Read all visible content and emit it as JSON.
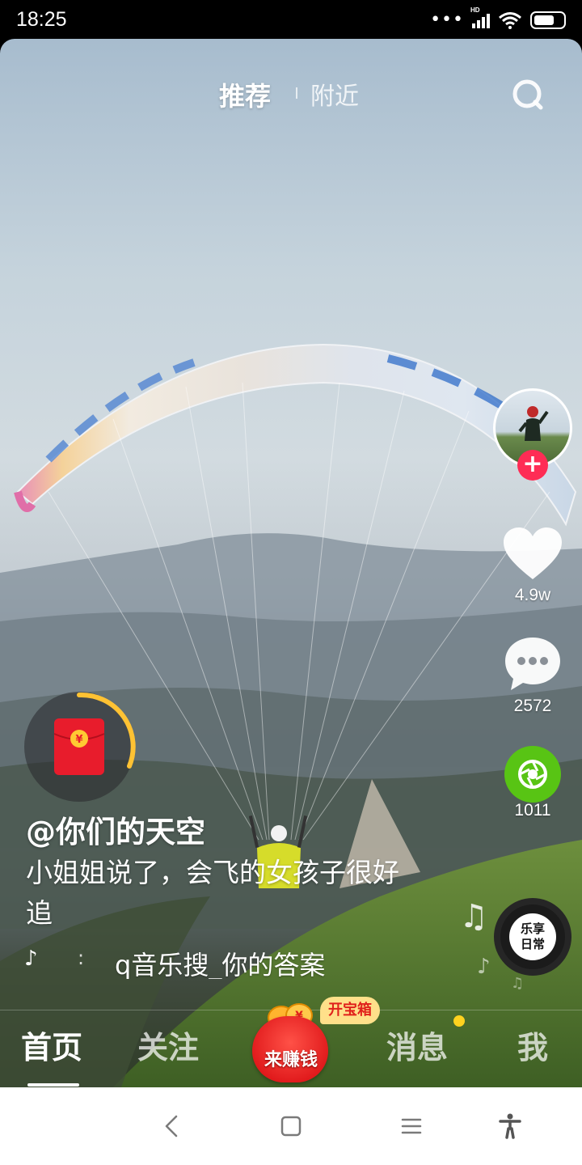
{
  "status_bar": {
    "time": "18:25",
    "network": "HD"
  },
  "top_tabs": {
    "recommend": "推荐",
    "nearby": "附近"
  },
  "actions": {
    "likes": "4.9w",
    "comments": "2572",
    "shares": "1011"
  },
  "caption": {
    "author": "@你们的天空",
    "description": "小姐姐说了，会飞的女孩子很好追",
    "music_dot": ":",
    "music": "q音乐搜_你的答案"
  },
  "music_disc": {
    "line1": "乐享",
    "line2": "日常"
  },
  "bottom_nav": {
    "home": "首页",
    "follow": "关注",
    "earn": "来赚钱",
    "chest": "开宝箱",
    "message": "消息",
    "me": "我"
  },
  "icons": {
    "search": "search-icon",
    "like": "heart-icon",
    "comment": "comment-icon",
    "share": "share-icon",
    "music": "music-note-icon",
    "red_packet": "red-packet-icon"
  },
  "colors": {
    "follow_red": "#fe2c55",
    "share_green": "#58c414",
    "badge_yellow": "#ffd21f",
    "red_packet": "#e0211b"
  }
}
